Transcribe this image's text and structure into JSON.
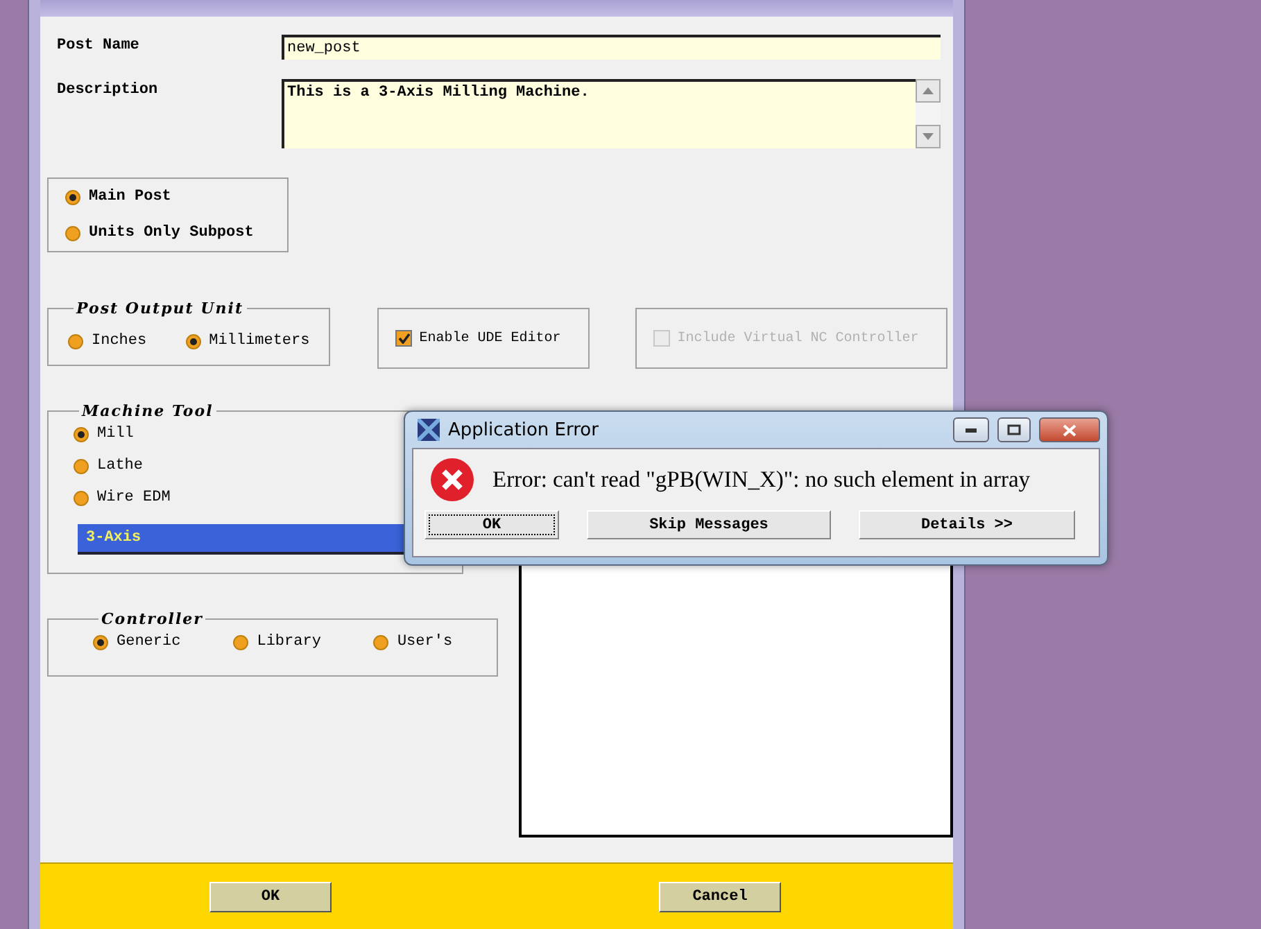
{
  "post_name": {
    "label": "Post Name",
    "value": "new_post"
  },
  "description": {
    "label": "Description",
    "value": "This is a 3-Axis Milling Machine."
  },
  "post_type": {
    "options": [
      {
        "label": "Main Post",
        "selected": true
      },
      {
        "label": "Units Only Subpost",
        "selected": false
      }
    ]
  },
  "output_unit": {
    "title": "Post Output Unit",
    "options": [
      {
        "label": "Inches",
        "selected": false
      },
      {
        "label": "Millimeters",
        "selected": true
      }
    ]
  },
  "checkboxes": [
    {
      "label": "Enable UDE Editor",
      "checked": true,
      "disabled": false
    },
    {
      "label": "Include Virtual NC Controller",
      "checked": false,
      "disabled": true
    }
  ],
  "machine_tool": {
    "title": "Machine Tool",
    "options": [
      {
        "label": "Mill",
        "selected": true
      },
      {
        "label": "Lathe",
        "selected": false
      },
      {
        "label": "Wire EDM",
        "selected": false
      }
    ],
    "axis_dropdown": {
      "value": "3-Axis"
    }
  },
  "controller": {
    "title": "Controller",
    "options": [
      {
        "label": "Generic",
        "selected": true
      },
      {
        "label": "Library",
        "selected": false
      },
      {
        "label": "User's",
        "selected": false
      }
    ]
  },
  "footer_buttons": [
    "OK",
    "Cancel"
  ],
  "error_dialog": {
    "title": "Application Error",
    "message": "Error: can't read \"gPB(WIN_X)\": no such element in array",
    "buttons": [
      {
        "label": "OK",
        "focused": true
      },
      {
        "label": "Skip Messages",
        "focused": false
      },
      {
        "label": "Details >>",
        "focused": false
      }
    ]
  }
}
